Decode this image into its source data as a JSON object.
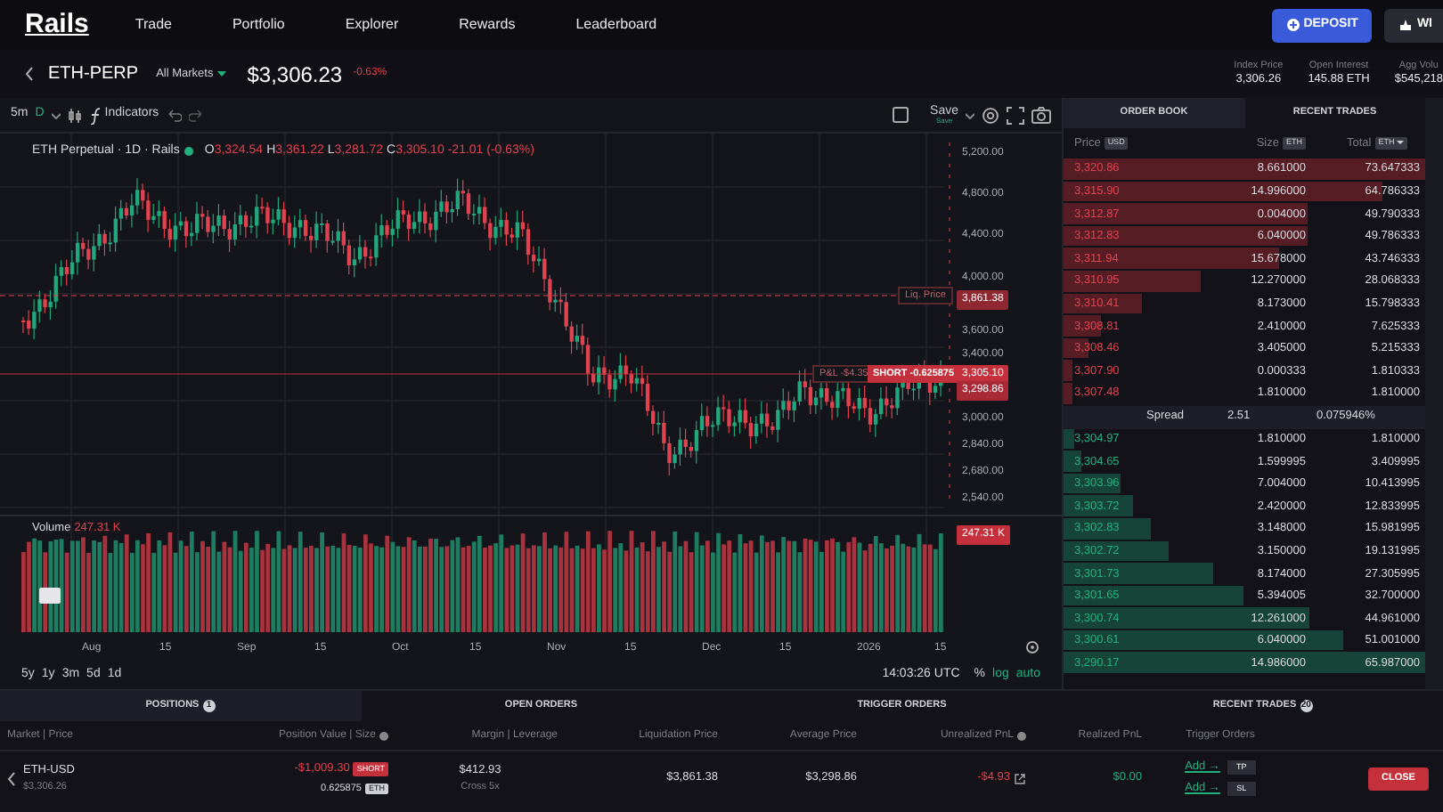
{
  "nav": {
    "logo": "Rails",
    "links": [
      "Trade",
      "Portfolio",
      "Explorer",
      "Rewards",
      "Leaderboard"
    ],
    "deposit": "DEPOSIT",
    "cut_button": "WI"
  },
  "market": {
    "symbol": "ETH-PERP",
    "selector": "All Markets",
    "price": "$3,306.23",
    "change": "-0.63%",
    "stats": [
      {
        "label": "Index Price",
        "value": "3,306.26"
      },
      {
        "label": "Open Interest",
        "value": "145.88 ETH"
      },
      {
        "label": "Agg Volu",
        "value": "$545,218"
      }
    ]
  },
  "chart": {
    "intervals": [
      {
        "label": "5m",
        "selected": false
      },
      {
        "label": "D",
        "selected": true
      }
    ],
    "indicators": "Indicators",
    "save": "Save",
    "save_status": "Save",
    "legend": {
      "title": "ETH Perpetual · 1D · Rails",
      "ohlc": [
        {
          "key": "O",
          "value": "3,324.54"
        },
        {
          "key": "H",
          "value": "3,361.22"
        },
        {
          "key": "L",
          "value": "3,281.72"
        },
        {
          "key": "C",
          "value": "3,305.10"
        }
      ],
      "change": "-21.01 (-0.63%)"
    },
    "price_ticks": [
      "5,200.00",
      "4,800.00",
      "4,400.00",
      "4,000.00",
      "3,600.00",
      "3,400.00",
      "3,000.00",
      "2,840.00",
      "2,680.00",
      "2,540.00"
    ],
    "liq_label": "Liq. Price",
    "liq_price": "3,861.38",
    "pnl": "P&L -$4.35",
    "side": "SHORT -0.625875",
    "last_price": "3,305.10",
    "mark_price": "3,298.86",
    "volume_label": "Volume",
    "volume_value": "247.31 K",
    "volume_tag": "247.31 K",
    "time_ticks": [
      "Aug",
      "15",
      "Sep",
      "15",
      "Oct",
      "15",
      "Nov",
      "15",
      "Dec",
      "15",
      "2026",
      "15"
    ],
    "ranges": [
      "5y",
      "1y",
      "3m",
      "5d",
      "1d"
    ],
    "clock": "14:03:26 UTC",
    "options": [
      {
        "label": "%",
        "on": false
      },
      {
        "label": "log",
        "on": true
      },
      {
        "label": "auto",
        "on": true
      }
    ]
  },
  "orderbook": {
    "tabs": [
      {
        "label": "ORDER BOOK",
        "selected": true
      },
      {
        "label": "RECENT TRADES",
        "selected": false
      }
    ],
    "columns": [
      {
        "label": "Price",
        "unit": "USD"
      },
      {
        "label": "Size",
        "unit": "ETH"
      },
      {
        "label": "Total",
        "unit": "ETH"
      }
    ],
    "asks": [
      {
        "price": "3,320.86",
        "size": "8.661000",
        "total": "73.647333"
      },
      {
        "price": "3,315.90",
        "size": "14.996000",
        "total": "64.786333"
      },
      {
        "price": "3,312.87",
        "size": "0.004000",
        "total": "49.790333"
      },
      {
        "price": "3,312.83",
        "size": "6.040000",
        "total": "49.786333"
      },
      {
        "price": "3,311.94",
        "size": "15.678000",
        "total": "43.746333"
      },
      {
        "price": "3,310.95",
        "size": "12.270000",
        "total": "28.068333"
      },
      {
        "price": "3,310.41",
        "size": "8.173000",
        "total": "15.798333"
      },
      {
        "price": "3,308.81",
        "size": "2.410000",
        "total": "7.625333"
      },
      {
        "price": "3,308.46",
        "size": "3.405000",
        "total": "5.215333"
      },
      {
        "price": "3,307.90",
        "size": "0.000333",
        "total": "1.810333"
      },
      {
        "price": "3,307.48",
        "size": "1.810000",
        "total": "1.810000"
      }
    ],
    "spread": {
      "label": "Spread",
      "value": "2.51",
      "percent": "0.075946%"
    },
    "bids": [
      {
        "price": "3,304.97",
        "size": "1.810000",
        "total": "1.810000"
      },
      {
        "price": "3,304.65",
        "size": "1.599995",
        "total": "3.409995"
      },
      {
        "price": "3,303.96",
        "size": "7.004000",
        "total": "10.413995"
      },
      {
        "price": "3,303.72",
        "size": "2.420000",
        "total": "12.833995"
      },
      {
        "price": "3,302.83",
        "size": "3.148000",
        "total": "15.981995"
      },
      {
        "price": "3,302.72",
        "size": "3.150000",
        "total": "19.131995"
      },
      {
        "price": "3,301.73",
        "size": "8.174000",
        "total": "27.305995"
      },
      {
        "price": "3,301.65",
        "size": "5.394005",
        "total": "32.700000"
      },
      {
        "price": "3,300.74",
        "size": "12.261000",
        "total": "44.961000"
      },
      {
        "price": "3,300.61",
        "size": "6.040000",
        "total": "51.001000"
      },
      {
        "price": "3,290.17",
        "size": "14.986000",
        "total": "65.987000"
      }
    ]
  },
  "positions": {
    "tabs": [
      {
        "label": "POSITIONS",
        "count": "1",
        "selected": true
      },
      {
        "label": "OPEN ORDERS",
        "selected": false
      },
      {
        "label": "TRIGGER ORDERS",
        "selected": false
      },
      {
        "label": "RECENT TRADES",
        "count": "20",
        "selected": false
      }
    ],
    "columns": [
      "Market | Price",
      "Position Value | Size",
      "Margin | Leverage",
      "Liquidation Price",
      "Average Price",
      "Unrealized PnL",
      "Realized PnL",
      "Trigger Orders"
    ],
    "rows": [
      {
        "market": "ETH-USD",
        "price": "$3,306.26",
        "value": "-$1,009.30",
        "side": "SHORT",
        "size": "0.625875",
        "size_unit": "ETH",
        "margin": "$412.93",
        "leverage": "Cross 5x",
        "liq": "$3,861.38",
        "avg": "$3,298.86",
        "unrealized": "-$4.93",
        "realized": "$0.00",
        "triggers": [
          {
            "label": "Add →",
            "type": "TP"
          },
          {
            "label": "Add →",
            "type": "SL"
          }
        ],
        "close": "CLOSE"
      }
    ]
  }
}
